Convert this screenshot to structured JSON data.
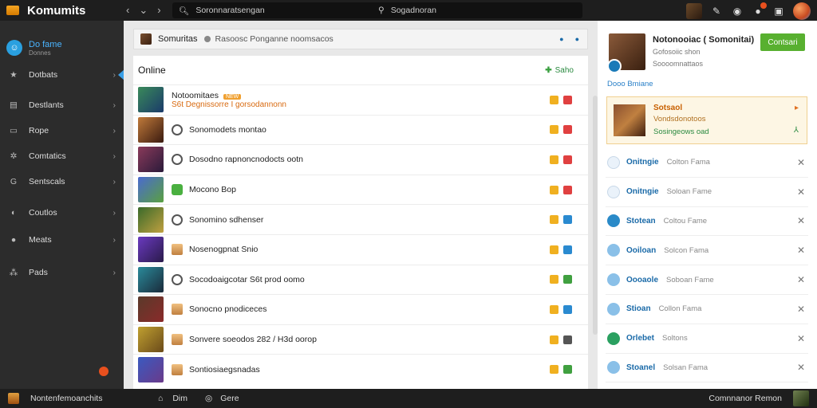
{
  "app": {
    "title": "Komumits",
    "search_left": "Soronnaratsengan",
    "search_right": "Sogadnoran"
  },
  "sidebar": {
    "profile_name": "Do fame",
    "profile_sub": "Donnes",
    "items": [
      {
        "label": "Dotbats",
        "icon": "star-icon"
      },
      {
        "label": "Destlants",
        "icon": "briefcase-icon"
      },
      {
        "label": "Rope",
        "icon": "chat-icon"
      },
      {
        "label": "Comtatics",
        "icon": "gear-icon"
      },
      {
        "label": "Sentscals",
        "icon": "refresh-icon"
      },
      {
        "label": "Coutlos",
        "icon": "globe-icon"
      },
      {
        "label": "Meats",
        "icon": "circle-icon"
      },
      {
        "label": "Pads",
        "icon": "people-icon"
      }
    ]
  },
  "main": {
    "crumb_title": "Somuritas",
    "crumb_desc": "Rasoosc Ponganne noomsacos",
    "list_title": "Online",
    "add_label": "Saho",
    "rows": [
      {
        "title": "Notoomitaes",
        "tag": "NEW",
        "sub": "S6t  Degnissorre I gorsodannonn",
        "thumb": "#3a8a5a,#1a3a6a",
        "icon": "none",
        "acts": [
          "y",
          "r"
        ]
      },
      {
        "title": "Sonomodets montao",
        "thumb": "#c07a3a,#3a1a10",
        "icon": "ring",
        "acts": [
          "y",
          "r"
        ]
      },
      {
        "title": "Dosodno rapnoncnodocts ootn",
        "thumb": "#8a3a5a,#2a1a3a",
        "icon": "ring",
        "acts": [
          "y",
          "r"
        ]
      },
      {
        "title": "Mocono Bop",
        "thumb": "#4a6ad0,#5aa040",
        "icon": "green",
        "acts": [
          "y",
          "r"
        ]
      },
      {
        "title": "Sonomino sdhenser",
        "thumb": "#3a6a2a,#c0a040",
        "icon": "ring",
        "acts": [
          "y",
          "b"
        ]
      },
      {
        "title": "Nosenogpnat Snio",
        "thumb": "#6a3ac0,#2a1a4a",
        "icon": "box",
        "acts": [
          "y",
          "b"
        ]
      },
      {
        "title": "Socodoaigcotar S6t prod oomo",
        "thumb": "#2a8a9a,#1a2a3a",
        "icon": "ring",
        "acts": [
          "y",
          "g"
        ]
      },
      {
        "title": "Sonocno pnodiceces",
        "thumb": "#5a3a2a,#8a2a2a",
        "icon": "box",
        "acts": [
          "y",
          "b"
        ]
      },
      {
        "title": "Sonvere soeodos 282 / H3d oorop",
        "thumb": "#c0a030,#6a4a1a",
        "icon": "box",
        "acts": [
          "y",
          "k"
        ]
      },
      {
        "title": "Sontiosiaegsnadas",
        "thumb": "#3a5ac0,#6a3a8a",
        "icon": "box",
        "acts": [
          "y",
          "g"
        ]
      }
    ]
  },
  "rpanel": {
    "name": "Notonooiac ( Somonitai)",
    "line1": "Gofosoiic shon",
    "line2": "Soooomnattaos",
    "button": "Contsari",
    "link": "Dooo Bmiane",
    "card_t1": "Sotsaol",
    "card_t2": "Vondsdonotoos",
    "card_t3": "Sosingeows  oad",
    "friends": [
      {
        "name": "Onitngie",
        "status": "Colton Fama",
        "av": ""
      },
      {
        "name": "Onitngie",
        "status": "Soloan Fame",
        "av": ""
      },
      {
        "name": "Stotean",
        "status": "Coltou Fame",
        "av": "blue"
      },
      {
        "name": "Ooiloan",
        "status": "Solcon Fama",
        "av": "lblue"
      },
      {
        "name": "Oooaole",
        "status": "Soboan Fame",
        "av": "lblue"
      },
      {
        "name": "Stioan",
        "status": "Collon Fama",
        "av": "lblue"
      },
      {
        "name": "Orlebet",
        "status": "Soltons",
        "av": "green"
      },
      {
        "name": "Stoanel",
        "status": "Solsan Fama",
        "av": "lblue"
      }
    ]
  },
  "bottombar": {
    "title": "Nontenfemoanchits",
    "home": "Dim",
    "game": "Gere",
    "right": "Comnnanor Remon"
  }
}
